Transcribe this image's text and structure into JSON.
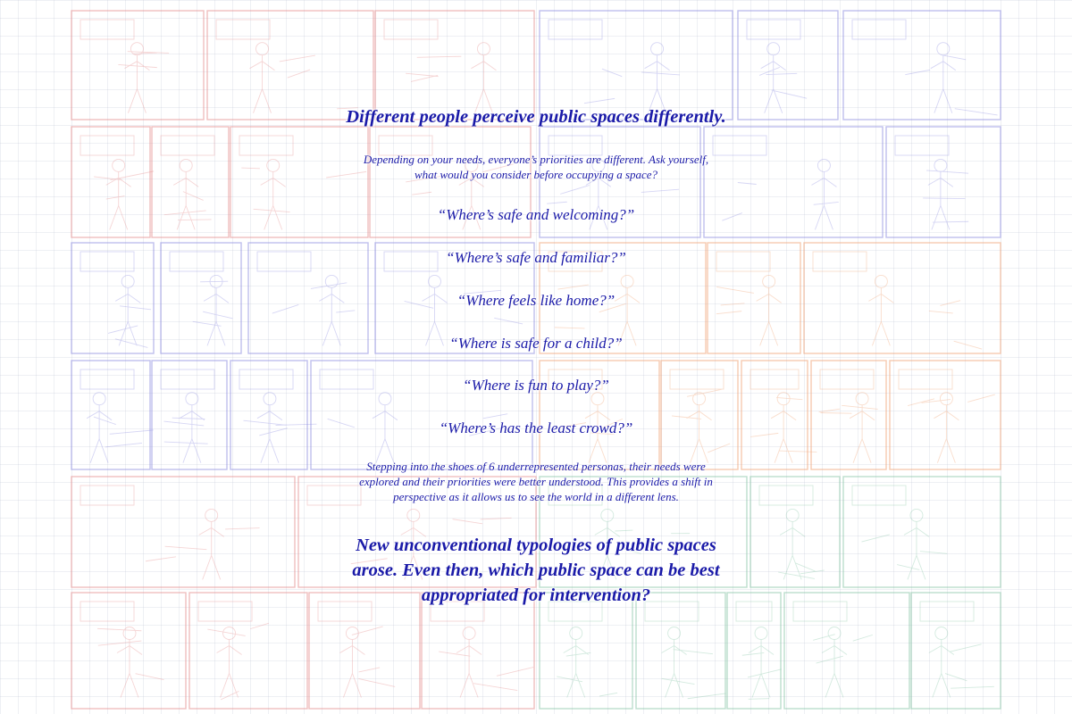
{
  "heading": "Different people perceive public spaces differently.",
  "intro_lines": [
    "Depending on your needs, everyone’s priorities are different. Ask yourself,",
    "what would you consider before occupying a space?"
  ],
  "questions": [
    "“Where’s safe and welcoming?”",
    "“Where’s safe and familiar?”",
    "“Where feels like home?”",
    "“Where is safe for a child?”",
    "“Where is fun to play?”",
    "“Where’s has the least crowd?”"
  ],
  "personas_lines": [
    "Stepping into the shoes of 6 underrepresented personas, their needs were",
    "explored and their priorities were better understood. This provides a shift in",
    "perspective as it allows us to see the world in a different lens."
  ],
  "closing_lines": [
    "New unconventional typologies of public spaces",
    "arose. Even then, which public space can be best",
    "appropriated for intervention?"
  ],
  "colors": {
    "text": "#1a1aa8",
    "panel_red": "#e58a8a",
    "panel_blue": "#8b8be0",
    "panel_orange": "#f0a070",
    "panel_green": "#84c4a4",
    "grid": "#b4b9cd"
  }
}
